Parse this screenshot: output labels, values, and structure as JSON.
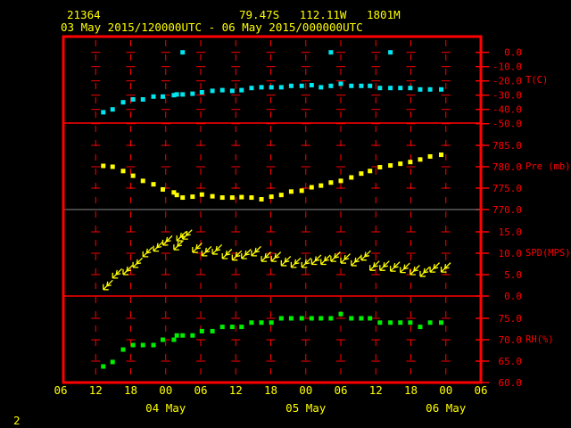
{
  "header": {
    "station_id": "21364",
    "location": "79.47S   112.11W   1801M",
    "period": "03 May 2015/120000UTC - 06 May 2015/000000UTC"
  },
  "page_number": "2",
  "colors": {
    "frame": "#ff0000",
    "text": "#ffff00",
    "temp": "#00e5ee",
    "pressure": "#ffff00",
    "wind": "#ffff00",
    "rh": "#00ee00",
    "grid_grey": "#888888"
  },
  "chart_data": {
    "type": "scatter",
    "title": "21364  79.47S 112.11W 1801M",
    "x_units": "hours since 03 May 2015 00UTC",
    "xlim": [
      6,
      78
    ],
    "x_tick_labels": [
      "06",
      "12",
      "18",
      "00",
      "06",
      "12",
      "18",
      "00",
      "06",
      "12",
      "18",
      "00",
      "06"
    ],
    "date_labels": [
      "04 May",
      "05 May",
      "06 May"
    ],
    "times": [
      13.3,
      14.9,
      16.7,
      18.4,
      20.1,
      21.9,
      23.5,
      25.4,
      25.9,
      26.9,
      28.6,
      30.2,
      32,
      33.7,
      35.4,
      37,
      38.7,
      40.4,
      42.1,
      43.8,
      45.5,
      47.3,
      49,
      50.6,
      52.3,
      54,
      55.8,
      57.5,
      59,
      60.7,
      62.5,
      64.2,
      65.9,
      67.6,
      69.3,
      71.2
    ],
    "panels": [
      {
        "name": "T(C)",
        "ylim": [
          -50,
          0
        ],
        "tick_labels": [
          "0.0",
          "-10.0",
          "-20.0",
          "-30.0",
          "-40.0",
          "-50.0"
        ],
        "tick_values": [
          0,
          -10,
          -20,
          -30,
          -40,
          -50
        ],
        "values": [
          -42,
          -40,
          -35,
          -33,
          -33,
          -31,
          -31,
          -30,
          -29.5,
          -29.5,
          -29,
          -28,
          -27,
          -26.5,
          -27,
          -26.5,
          -25,
          -24.5,
          -24.5,
          -24.5,
          -23.5,
          -23.5,
          -23,
          -24.5,
          -23.5,
          -22,
          -23.5,
          -23.5,
          -23.5,
          -25,
          -25,
          -25,
          -25,
          -26,
          -26,
          -26
        ],
        "outliers": [
          {
            "t": 26.9,
            "v": 0
          },
          {
            "t": 52.3,
            "v": 0
          },
          {
            "t": 62.5,
            "v": 0
          }
        ]
      },
      {
        "name": "Pre (mb)",
        "ylim": [
          770,
          788
        ],
        "tick_labels": [
          "785.0",
          "780.0",
          "775.0",
          "770.0"
        ],
        "tick_values": [
          785,
          780,
          775,
          770
        ],
        "values": [
          780.2,
          780,
          779,
          777.9,
          776.7,
          775.9,
          774.7,
          774,
          773.4,
          772.8,
          773,
          773.5,
          773.1,
          772.8,
          772.8,
          772.9,
          772.8,
          772.4,
          773,
          773.4,
          774.2,
          774.4,
          775.2,
          775.6,
          776.3,
          776.7,
          777.5,
          778.4,
          779,
          779.9,
          780.3,
          780.7,
          781.1,
          781.7,
          782.4,
          782.8
        ]
      },
      {
        "name": "SPD(MPS)",
        "ylim": [
          0,
          18
        ],
        "tick_labels": [
          "15.0",
          "10.0",
          "5.0",
          "0.0"
        ],
        "tick_values": [
          15,
          10,
          5,
          0
        ],
        "values": [
          1.5,
          4.2,
          5,
          6.7,
          9.2,
          10.5,
          11.9,
          10.8,
          12.9,
          13.3,
          10.2,
          9.4,
          9.8,
          8.75,
          8.4,
          8.75,
          9.4,
          8.1,
          8.1,
          7.1,
          6.7,
          6.7,
          7.4,
          7.4,
          8.1,
          7.7,
          7.1,
          8.4,
          6,
          6,
          5.8,
          5.5,
          5,
          4.6,
          5.6,
          5.6
        ],
        "direction_deg": 45
      },
      {
        "name": "RH(%)",
        "ylim": [
          60,
          78
        ],
        "tick_labels": [
          "75.0",
          "70.0",
          "65.0",
          "60.0"
        ],
        "tick_values": [
          75,
          70,
          65,
          60
        ],
        "values": [
          63.75,
          64.8,
          67.7,
          68.75,
          68.75,
          68.75,
          70,
          70,
          71,
          71,
          71,
          72,
          72,
          73,
          73,
          73,
          74,
          74,
          74,
          75,
          75,
          75,
          75,
          75,
          75,
          76,
          75,
          75,
          75,
          74,
          74,
          74,
          74,
          73,
          74,
          74
        ]
      }
    ]
  }
}
